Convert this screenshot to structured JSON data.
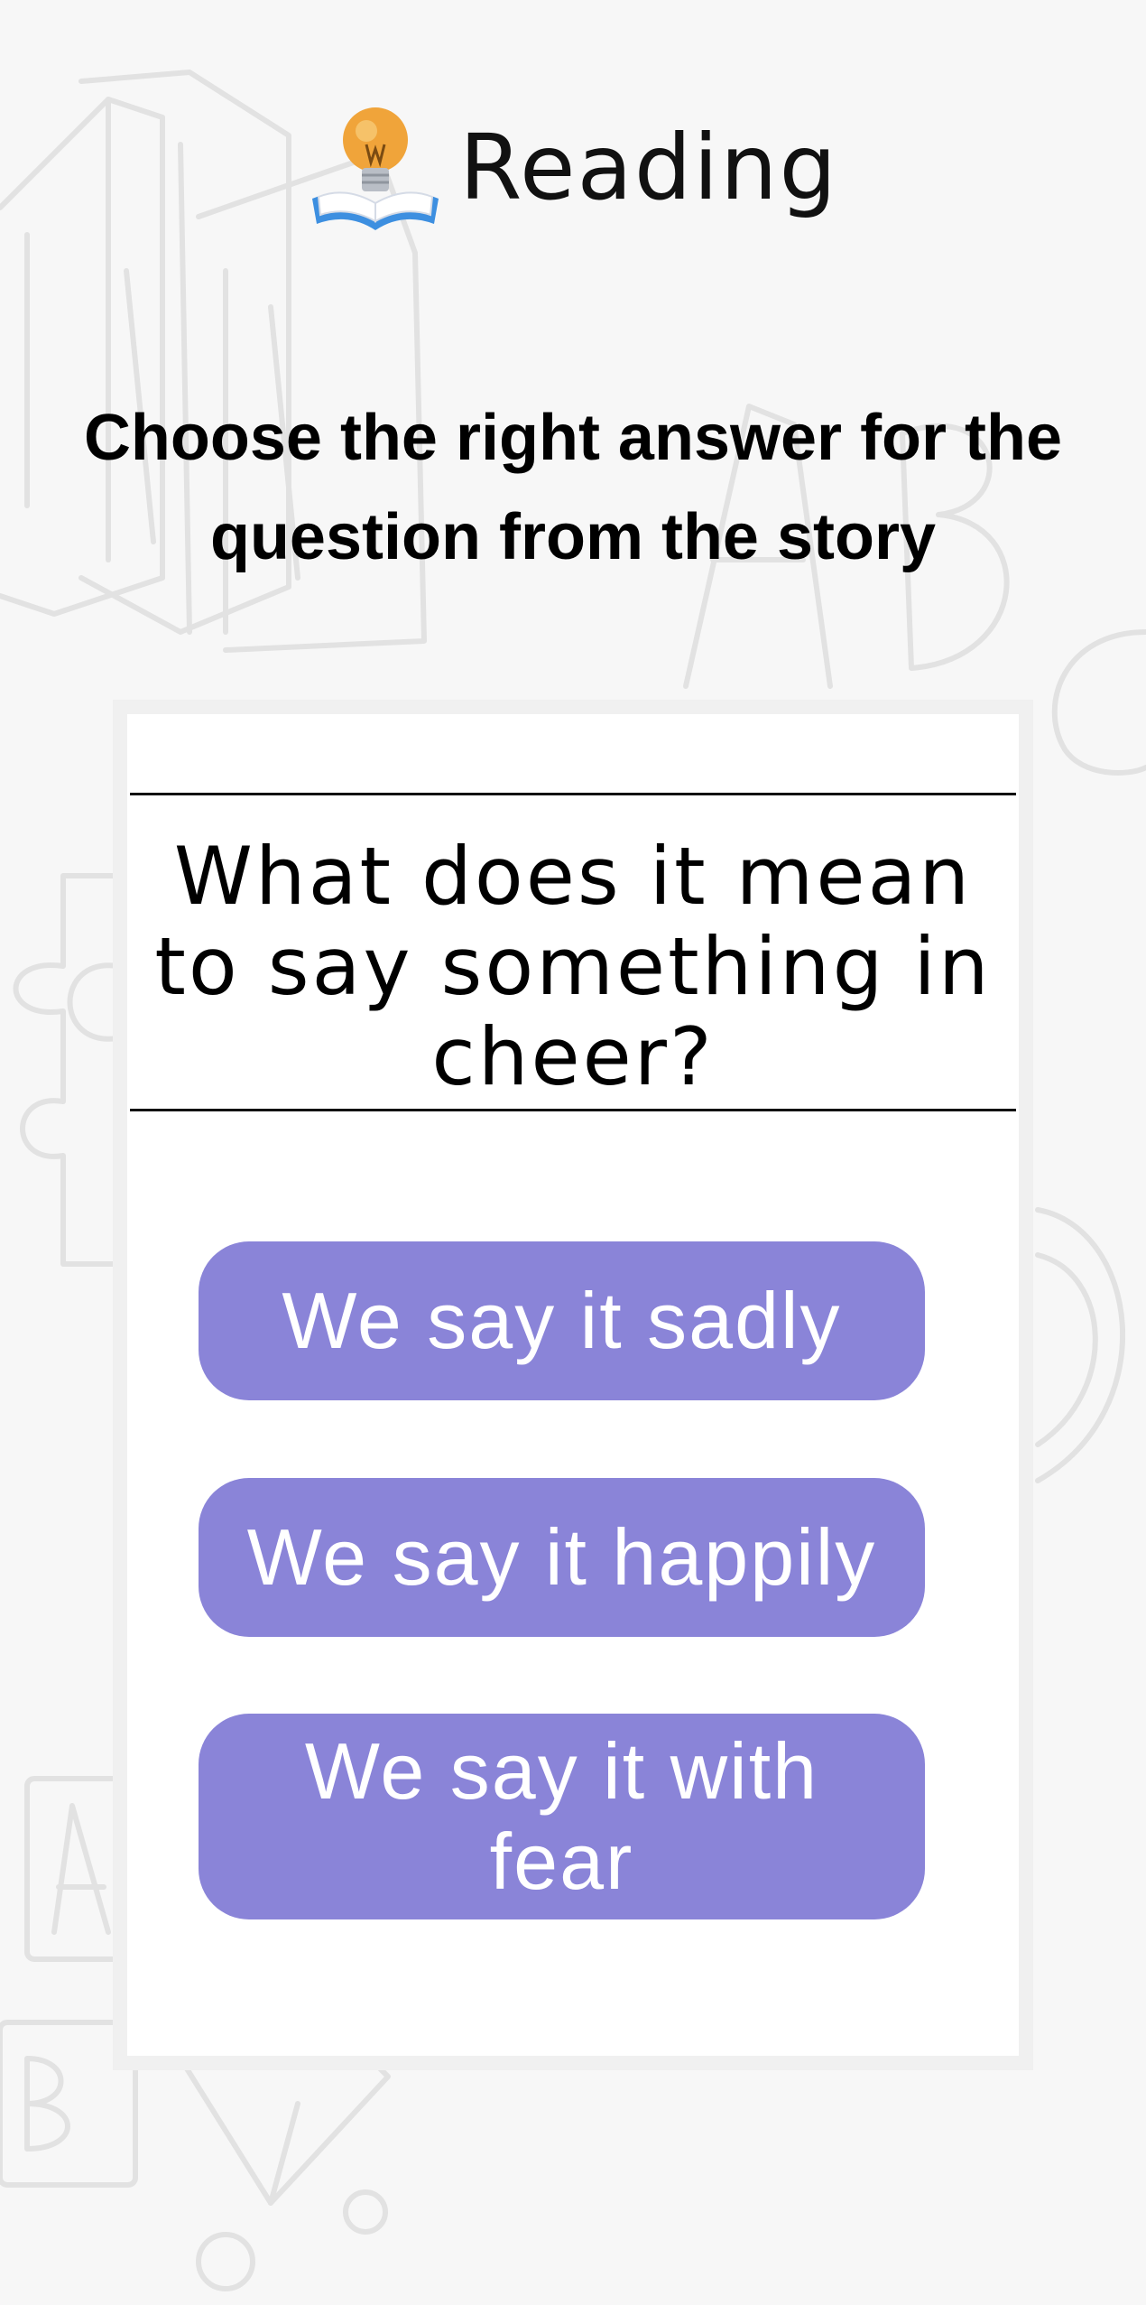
{
  "header": {
    "icon": "lightbulb-book-icon",
    "title": "Reading"
  },
  "instruction": "Choose the right answer for the question from the story",
  "question": "What does it mean to say something in cheer?",
  "answers": [
    {
      "label": "We say it sadly"
    },
    {
      "label": "We say it happily"
    },
    {
      "label": "We say it with fear"
    }
  ],
  "colors": {
    "background": "#f7f7f7",
    "card": "#ffffff",
    "card_border": "#f0f0f0",
    "answer_button": "#8a84d8",
    "answer_text": "#ffffff",
    "text": "#000000",
    "doodle": "#e2e2e2"
  }
}
